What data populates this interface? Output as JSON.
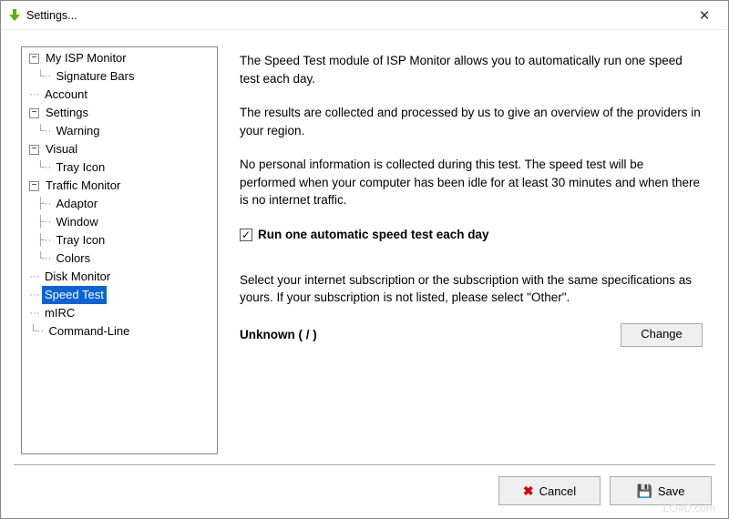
{
  "window": {
    "title": "Settings..."
  },
  "tree": {
    "my_isp_monitor": "My ISP Monitor",
    "signature_bars": "Signature Bars",
    "account": "Account",
    "settings": "Settings",
    "warning": "Warning",
    "visual": "Visual",
    "tray_icon_visual": "Tray Icon",
    "traffic_monitor": "Traffic Monitor",
    "adaptor": "Adaptor",
    "window_item": "Window",
    "tray_icon_traffic": "Tray Icon",
    "colors": "Colors",
    "disk_monitor": "Disk Monitor",
    "speed_test": "Speed Test",
    "mirc": "mIRC",
    "command_line": "Command-Line"
  },
  "pane": {
    "p1": "The Speed Test module of ISP Monitor allows you to automatically run one speed test each day.",
    "p2": "The results are collected and processed by us to give an overview of the providers in your region.",
    "p3": "No personal information is collected during this test. The speed test will be performed when your computer has been idle for at least 30 minutes and when there is no internet traffic.",
    "checkbox_label": "Run one automatic speed test each day",
    "p4": "Select your internet subscription or the subscription with the same specifications as yours. If your subscription is not listed, please select \"Other\".",
    "subscription_value": "Unknown  ( / )",
    "change_button": "Change"
  },
  "buttons": {
    "cancel": "Cancel",
    "save": "Save"
  },
  "watermark": "LO4D.com"
}
